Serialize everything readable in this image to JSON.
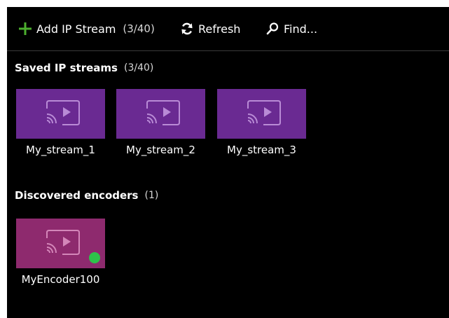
{
  "toolbar": {
    "add_label": "Add IP Stream",
    "add_count": "(3/40)",
    "refresh_label": "Refresh",
    "find_label": "Find..."
  },
  "saved_section": {
    "title": "Saved IP streams",
    "count": "(3/40)",
    "streams": [
      {
        "name": "My_stream_1",
        "icon": "cast-icon"
      },
      {
        "name": "My_stream_2",
        "icon": "cast-icon"
      },
      {
        "name": "My_stream_3",
        "icon": "cast-icon"
      }
    ]
  },
  "discovered_section": {
    "title": "Discovered encoders",
    "count": "(1)",
    "encoders": [
      {
        "name": "MyEncoder100",
        "icon": "cast-icon",
        "status": "online"
      }
    ]
  },
  "colors": {
    "background": "#000000",
    "stream_tile": "#6a2a92",
    "encoder_tile": "#8e2a6e",
    "add_icon": "#4caf2e",
    "status_online": "#2dc24a"
  }
}
